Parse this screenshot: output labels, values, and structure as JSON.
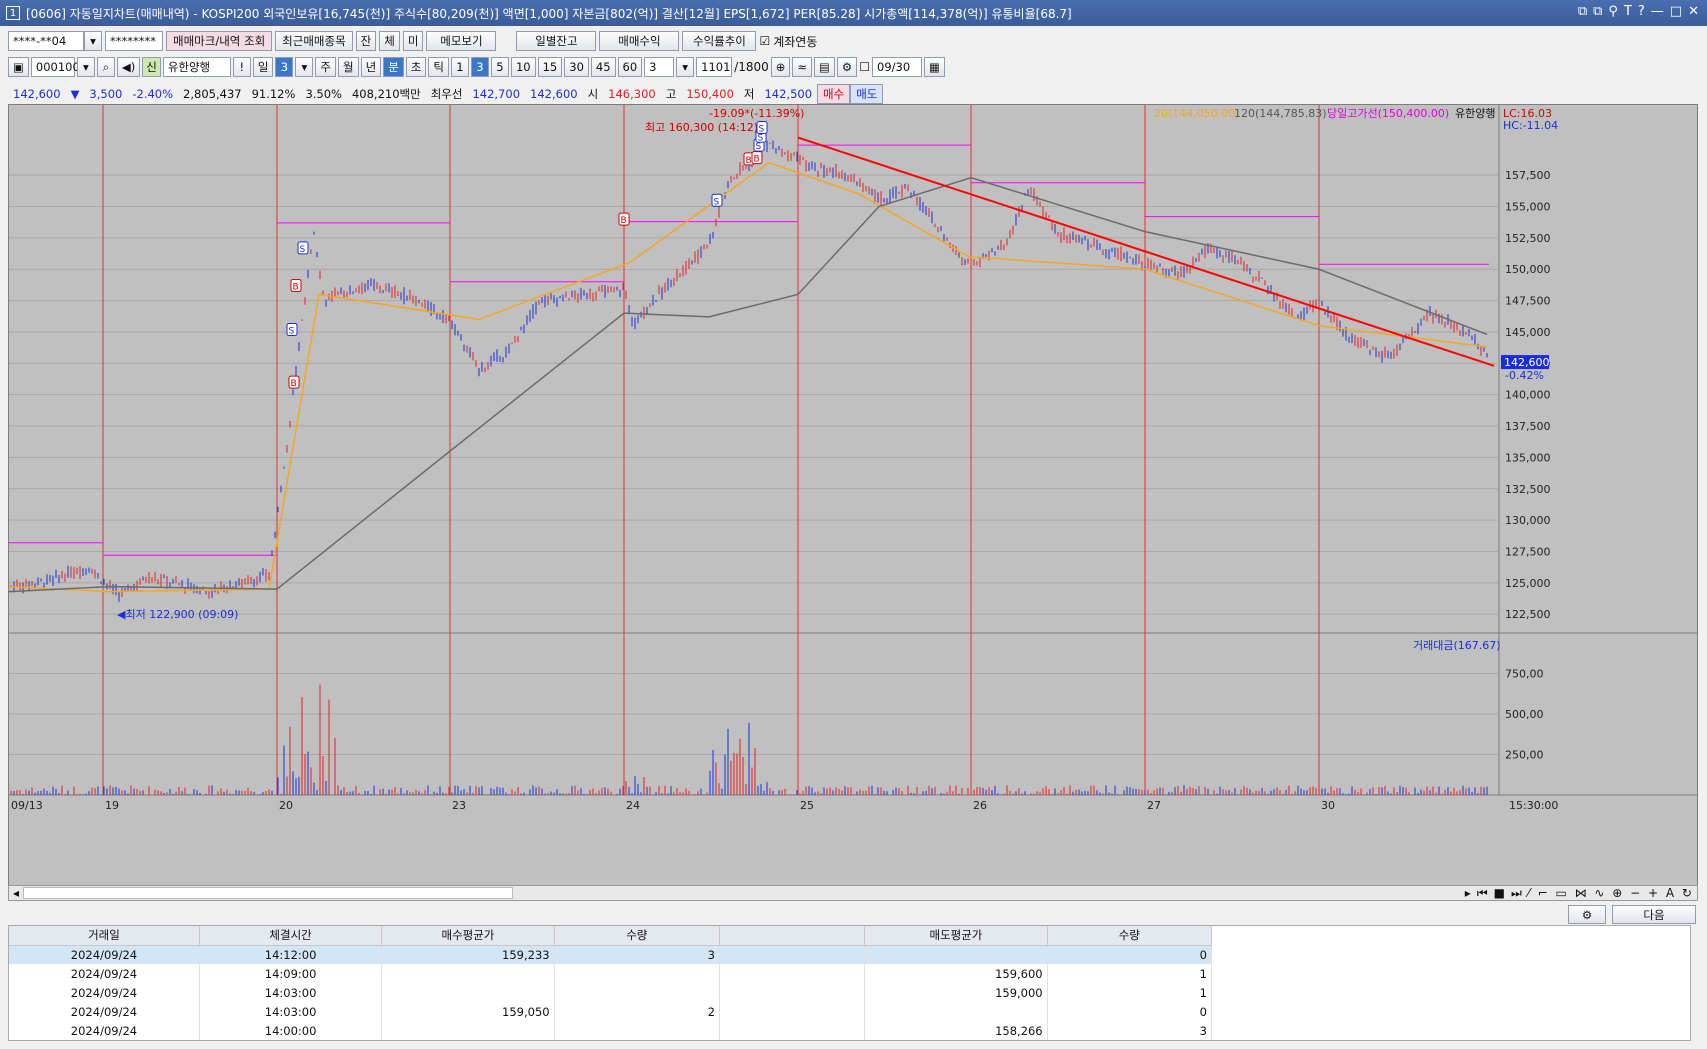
{
  "window": {
    "title": "[0606] 자동일지차트(매매내역) - KOSPI200 외국인보유[16,745(천)] 주식수[80,209(천)] 액면[1,000] 자본금[802(억)] 결산[12월] EPS[1,672] PER[85.28] 시가총액[114,378(억)] 유통비율[68.7]",
    "controls": [
      "⧉",
      "⧉",
      "⚲",
      "T",
      "?",
      "—",
      "□",
      "✕"
    ]
  },
  "toolbar1": {
    "account": "****-**04",
    "password": "********",
    "btn_trade_mark": "매매마크/내역 조회",
    "btn_recent": "최근매매종목",
    "btn_jan": "잔",
    "btn_che": "체",
    "btn_mi": "미",
    "btn_memo": "메모보기",
    "btn_daily": "일별잔고",
    "btn_profit": "매매수익",
    "btn_return": "수익률추이",
    "chk_link": "계좌연동"
  },
  "toolbar2": {
    "code": "000100",
    "stock_badge": "신",
    "stock_name": "유한양행",
    "excl": "!",
    "day": "일",
    "day_n": "3",
    "periods": [
      "주",
      "월",
      "년",
      "분",
      "초",
      "틱"
    ],
    "period_active": "분",
    "intervals": [
      "1",
      "3",
      "5",
      "10",
      "15",
      "30",
      "45",
      "60"
    ],
    "interval_active": "3",
    "count_sel": "3",
    "range": "1101",
    "range_total": "/1800",
    "date": "09/30"
  },
  "quote": {
    "price": "142,600",
    "change": "3,500",
    "change_pct": "-2.40%",
    "volume": "2,805,437",
    "vol_ratio": "91.12%",
    "rate": "3.50%",
    "amount": "408,210백만",
    "best_label": "최우선",
    "ask": "142,700",
    "bid": "142,600",
    "open_label": "시",
    "open": "146,300",
    "high_label": "고",
    "high": "150,400",
    "low_label": "저",
    "low": "142,500",
    "buy_btn": "매수",
    "sell_btn": "매도"
  },
  "chart": {
    "legend_ma20": "20(144,050.00)",
    "legend_ma120": "120(144,785.83)",
    "legend_high_line": "당일고가선(150,400.00)",
    "legend_stock": "유한양행",
    "lc": "LC:16.03",
    "hc": "HC:-11.04",
    "annot_drop": "-19.09*(-11.39%)",
    "annot_high": "최고 160,300 (14:12)",
    "annot_low": "최저 122,900 (09:09)",
    "price_tag": "142,600",
    "price_tag_pct": "-0.42%",
    "volume_legend": "거래대금(167.67)",
    "time_label": "15:30:00",
    "colors": {
      "up": "#e02020",
      "down": "#1a2ed8",
      "ma20": "#f5a623",
      "ma120": "#6b6b6b",
      "trend": "#ff0000",
      "dayhigh": "#ff00ff",
      "sep": "#e03030"
    }
  },
  "chart_data": {
    "type": "line",
    "title": "",
    "x": [
      "09/13",
      "19",
      "20",
      "23",
      "24",
      "25",
      "26",
      "27",
      "30"
    ],
    "y_ticks": [
      "122,500",
      "125,000",
      "127,500",
      "130,000",
      "132,500",
      "135,000",
      "137,500",
      "140,000",
      "142,500",
      "145,000",
      "147,500",
      "150,000",
      "152,500",
      "155,000",
      "157,500"
    ],
    "volume_ticks": [
      "250,00",
      "500,00",
      "750,00"
    ],
    "series": [
      {
        "name": "20(144,050.00)",
        "values": [
          124700,
          124300,
          124500,
          148000,
          146000,
          150500,
          158500,
          156000,
          151000,
          150000,
          145500,
          143800
        ]
      },
      {
        "name": "120(144,785.83)",
        "values": [
          124300,
          124700,
          124500,
          135500,
          146500,
          146200,
          148000,
          155000,
          157300,
          153000,
          150000,
          144800
        ]
      }
    ],
    "ylim": [
      121000,
      161500
    ]
  },
  "table": {
    "headers": [
      "거래일",
      "체결시간",
      "매수평균가",
      "수량",
      "",
      "매도평균가",
      "수량"
    ],
    "rows": [
      [
        "2024/09/24",
        "14:12:00",
        "159,233",
        "3",
        "",
        "",
        "0"
      ],
      [
        "2024/09/24",
        "14:09:00",
        "",
        "",
        "",
        "159,600",
        "1"
      ],
      [
        "2024/09/24",
        "14:03:00",
        "",
        "",
        "",
        "159,000",
        "1"
      ],
      [
        "2024/09/24",
        "14:03:00",
        "159,050",
        "2",
        "",
        "",
        "0"
      ],
      [
        "2024/09/24",
        "14:00:00",
        "",
        "",
        "",
        "158,266",
        "3"
      ]
    ],
    "next_btn": "다음"
  }
}
